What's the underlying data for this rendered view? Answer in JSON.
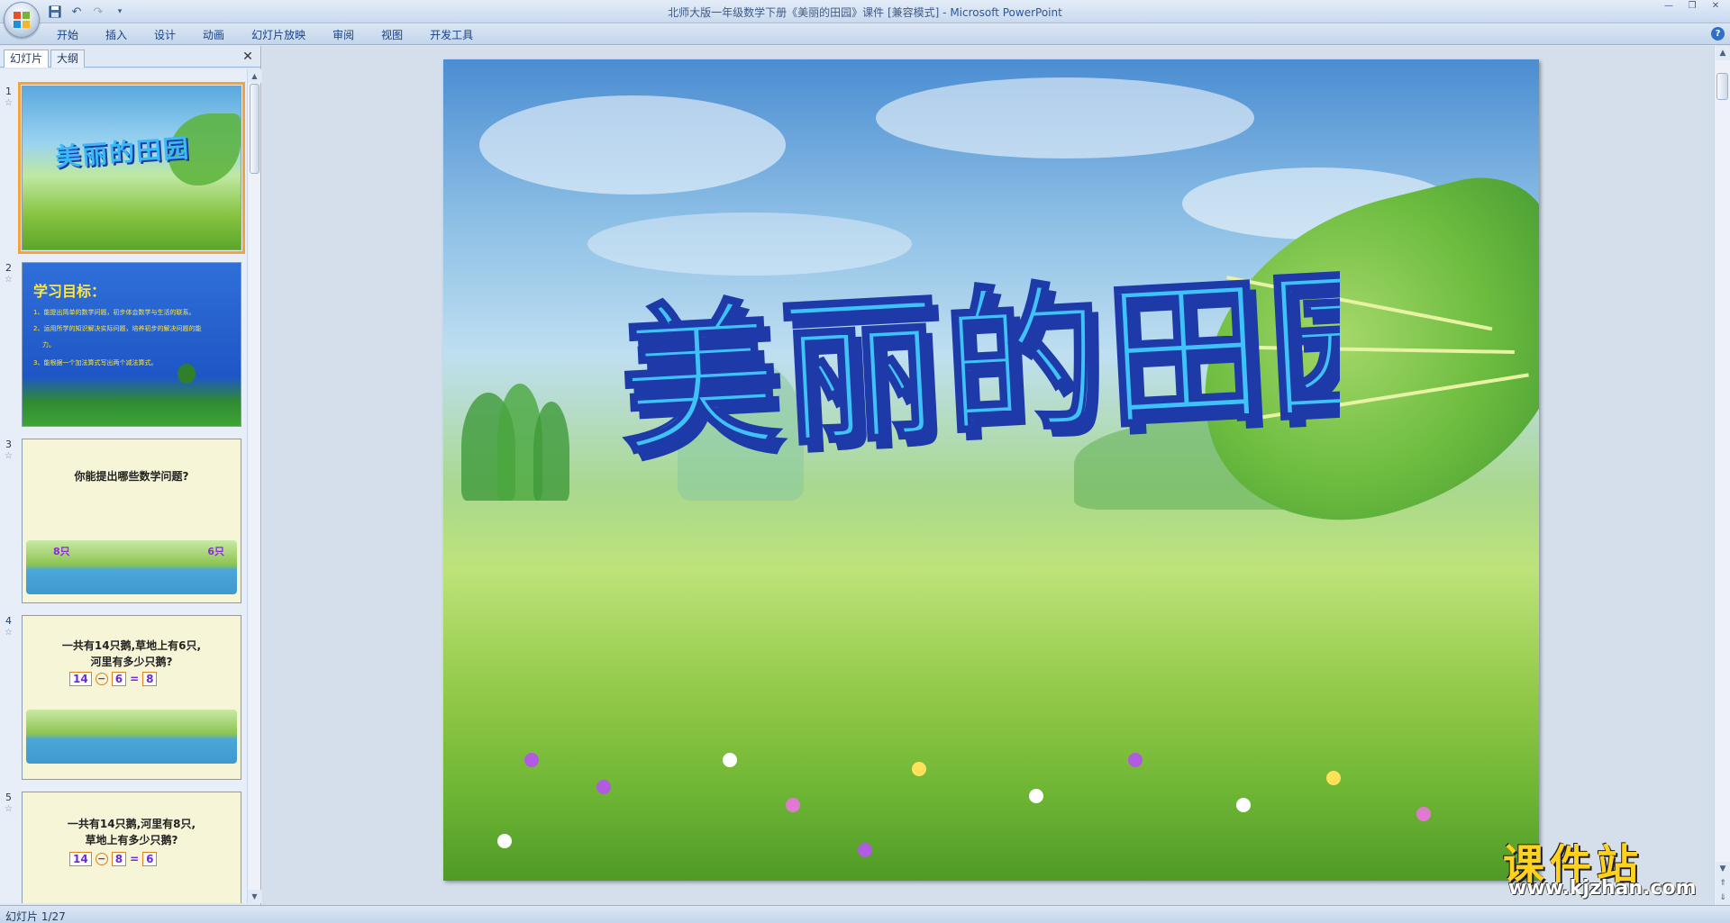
{
  "window": {
    "title_doc": "北师大版一年级数学下册《美丽的田园》课件 [兼容模式] - ",
    "title_app": "Microsoft PowerPoint"
  },
  "ribbon": {
    "tabs": [
      "开始",
      "插入",
      "设计",
      "动画",
      "幻灯片放映",
      "审阅",
      "视图",
      "开发工具"
    ]
  },
  "left_pane": {
    "tabs": [
      "幻灯片",
      "大纲"
    ],
    "thumbnails": [
      {
        "num": "1",
        "title": "美丽的田园"
      },
      {
        "num": "2",
        "title": "学习目标：",
        "items": [
          "1、能提出简单的数学问题，初步体会数学与生活的联系。",
          "2、运用所学的知识解决实际问题，培养初步的解决问题的能",
          "力。",
          "3、能根据一个加法算式写出两个减法算式。"
        ]
      },
      {
        "num": "3",
        "question": "你能提出哪些数学问题?",
        "left_label": "8只",
        "right_label": "6只"
      },
      {
        "num": "4",
        "question_line1": "一共有14只鹅,草地上有6只,",
        "question_line2": "河里有多少只鹅?",
        "eq": [
          "14",
          "−",
          "6",
          "=",
          "8"
        ]
      },
      {
        "num": "5",
        "question_line1": "一共有14只鹅,河里有8只,",
        "question_line2": "草地上有多少只鹅?",
        "eq": [
          "14",
          "−",
          "8",
          "=",
          "6"
        ]
      }
    ]
  },
  "slide": {
    "title": "美丽的田园"
  },
  "watermark": {
    "cn": "课件站",
    "url": "www.kjzhan.com"
  },
  "status": {
    "slide_counter": "幻灯片 1/27"
  }
}
